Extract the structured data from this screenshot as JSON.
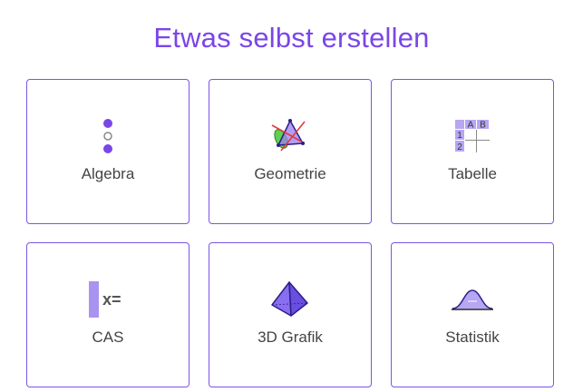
{
  "header": {
    "title": "Etwas selbst erstellen"
  },
  "colors": {
    "accent": "#7a46e8",
    "card_border": "#7c55e6",
    "label_text": "#444444"
  },
  "apps": [
    {
      "label": "Algebra",
      "icon": "algebra-icon"
    },
    {
      "label": "Geometrie",
      "icon": "geometry-icon"
    },
    {
      "label": "Tabelle",
      "icon": "spreadsheet-icon"
    },
    {
      "label": "CAS",
      "icon": "cas-icon"
    },
    {
      "label": "3D Grafik",
      "icon": "3d-graphics-icon"
    },
    {
      "label": "Statistik",
      "icon": "statistics-icon"
    }
  ],
  "icon_text": {
    "table_col_a": "A",
    "table_col_b": "B",
    "table_row_1": "1",
    "table_row_2": "2",
    "cas_symbol": "x="
  }
}
